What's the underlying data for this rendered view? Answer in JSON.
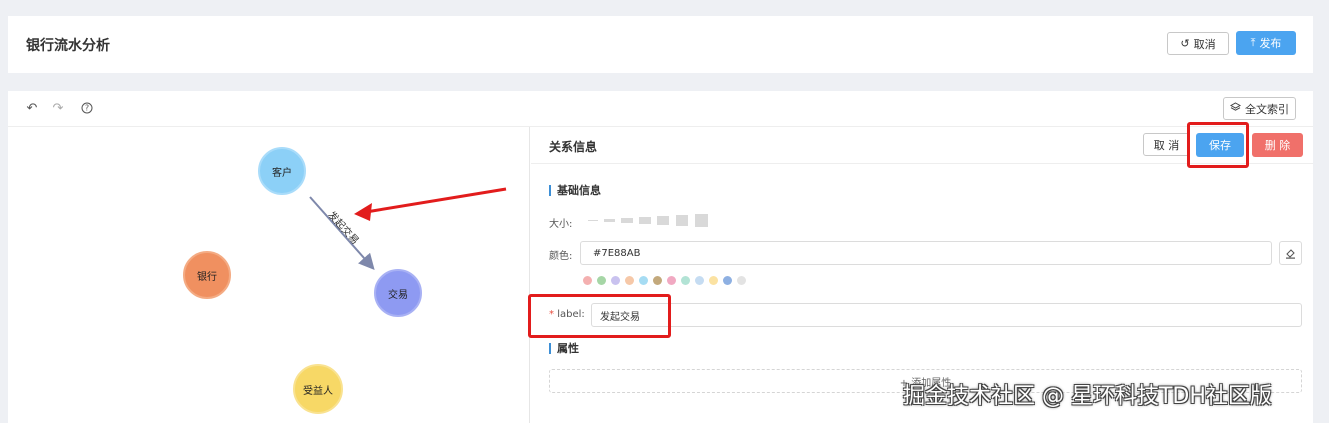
{
  "header": {
    "title": "银行流水分析",
    "cancel_label": "取消",
    "cancel_icon": "undo-icon",
    "publish_label": "发布",
    "publish_icon": "upload-icon"
  },
  "toolbar": {
    "undo_icon": "undo-icon",
    "redo_icon": "redo-icon",
    "help_icon": "help-icon",
    "fulltext_label": "全文索引",
    "fulltext_icon": "layers-icon"
  },
  "graph": {
    "nodes": [
      {
        "label": "客户",
        "color": "#8cd0f7"
      },
      {
        "label": "银行",
        "color": "#f09060"
      },
      {
        "label": "交易",
        "color": "#8e9af2"
      },
      {
        "label": "受益人",
        "color": "#f7d866"
      }
    ],
    "edge_label": "发起交易",
    "edge_color": "#7E88AB"
  },
  "panel": {
    "title": "关系信息",
    "cancel_label": "取 消",
    "save_label": "保存",
    "delete_label": "删 除",
    "basic_section": "基础信息",
    "size_label": "大小:",
    "color_label": "颜色:",
    "color_value": "#7E88AB",
    "swatches": [
      "#f4b0b0",
      "#a6d6a6",
      "#c9c2ef",
      "#f6c8a8",
      "#a6dcf3",
      "#c3a97c",
      "#f1a9c2",
      "#b2e3d5",
      "#c5dcf2",
      "#fbe2a2",
      "#8eb0e2",
      "#e3e3e3"
    ],
    "label_required": "*",
    "label_label": "label:",
    "label_value": "发起交易",
    "attr_section": "属性",
    "add_attr_label": "+ 添加属性"
  },
  "accent": {
    "primary": "#4ba4f0",
    "danger": "#f0706a",
    "highlight": "#e21c1c"
  },
  "watermark": "掘金技术社区 @ 星环科技TDH社区版"
}
